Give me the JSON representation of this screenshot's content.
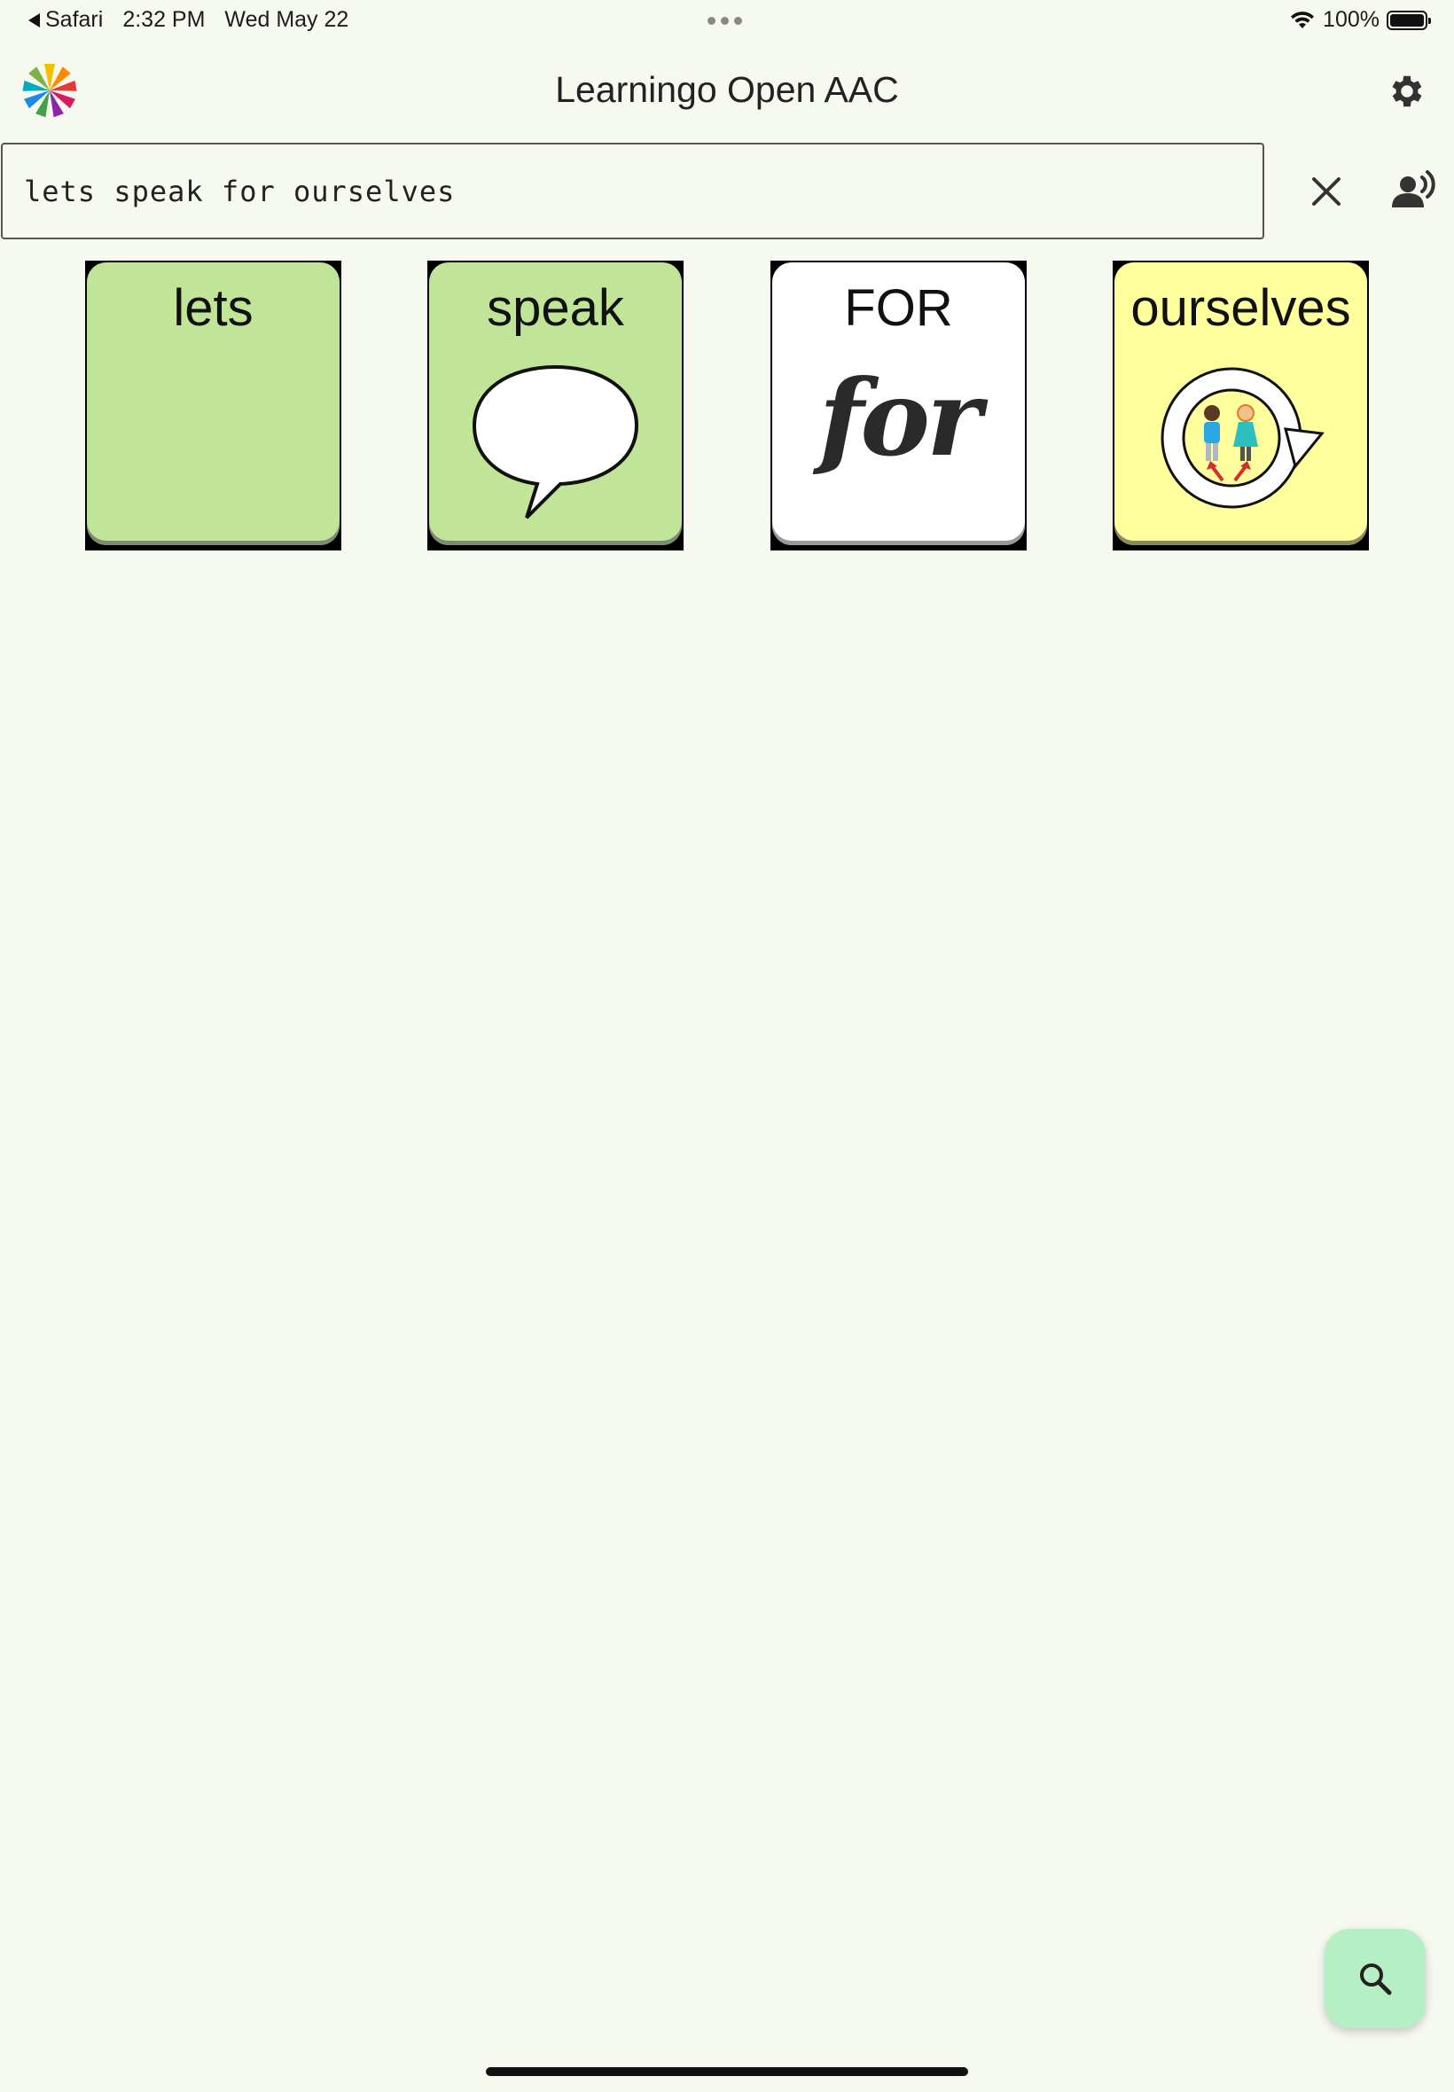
{
  "status_bar": {
    "back_app": "Safari",
    "time": "2:32 PM",
    "date": "Wed May 22",
    "battery": "100%"
  },
  "header": {
    "title": "Learningo Open AAC"
  },
  "sentence_bar": {
    "text": "lets speak for ourselves"
  },
  "tiles": [
    {
      "label": "lets",
      "color": "#c1e598"
    },
    {
      "label": "speak",
      "color": "#c1e598"
    },
    {
      "label": "FOR",
      "color": "#ffffff",
      "symbol_text": "for"
    },
    {
      "label": "ourselves",
      "color": "#ffff9e"
    }
  ],
  "colors": {
    "background": "#f6f9f0",
    "fab": "#b5efc4"
  },
  "icons": {
    "clear": "close-icon",
    "speak": "speak-icon",
    "settings": "gear-icon",
    "search": "search-icon"
  }
}
